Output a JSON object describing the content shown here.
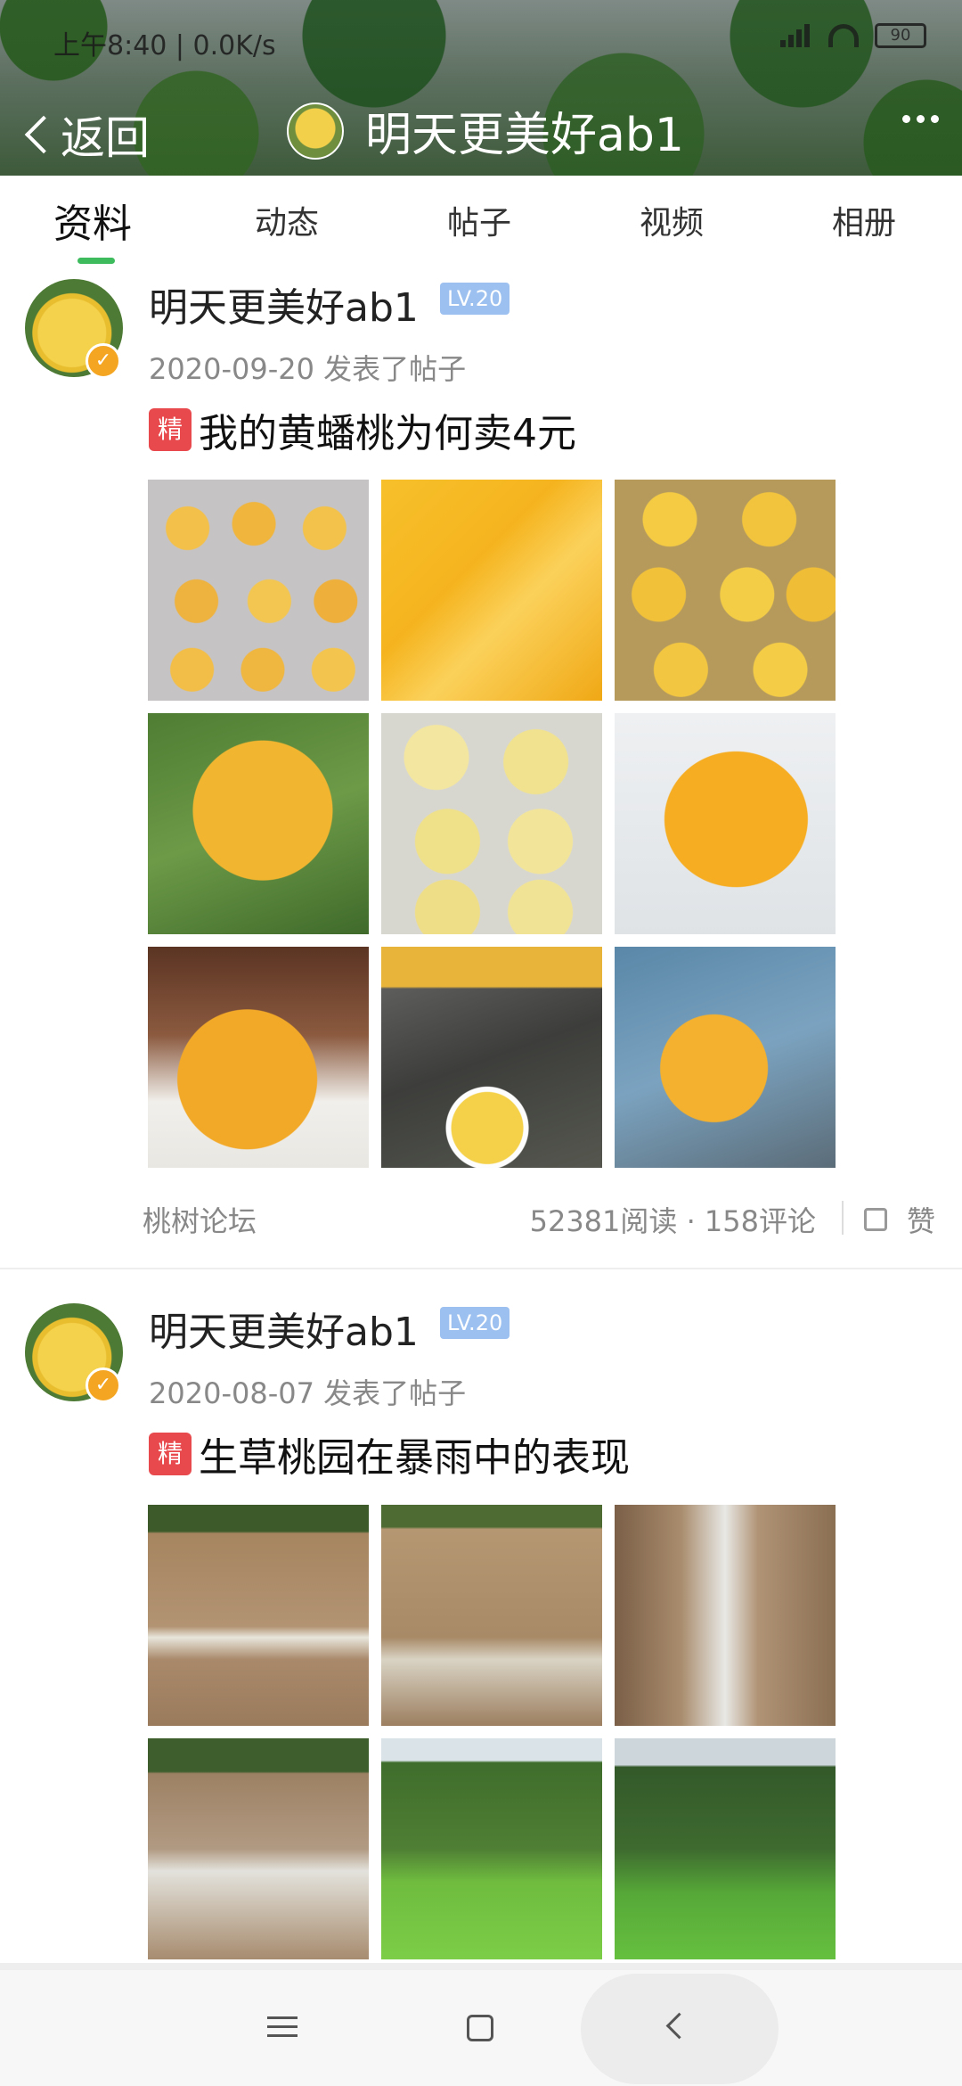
{
  "status_bar": {
    "time": "上午8:40 | 0.0K/s",
    "battery": "90"
  },
  "nav": {
    "back_label": "返回",
    "title": "明天更美好ab1"
  },
  "tabs": [
    "资料",
    "动态",
    "帖子",
    "视频",
    "相册"
  ],
  "posts": [
    {
      "username": "明天更美好ab1",
      "level": "LV.20",
      "meta": "2020-09-20  发表了帖子",
      "badge": "精",
      "title": "我的黄蟠桃为何卖4元",
      "forum": "桃树论坛",
      "stats": "52381阅读 · 158评论",
      "like_label": "赞"
    },
    {
      "username": "明天更美好ab1",
      "level": "LV.20",
      "meta": "2020-08-07  发表了帖子",
      "badge": "精",
      "title": "生草桃园在暴雨中的表现"
    }
  ]
}
